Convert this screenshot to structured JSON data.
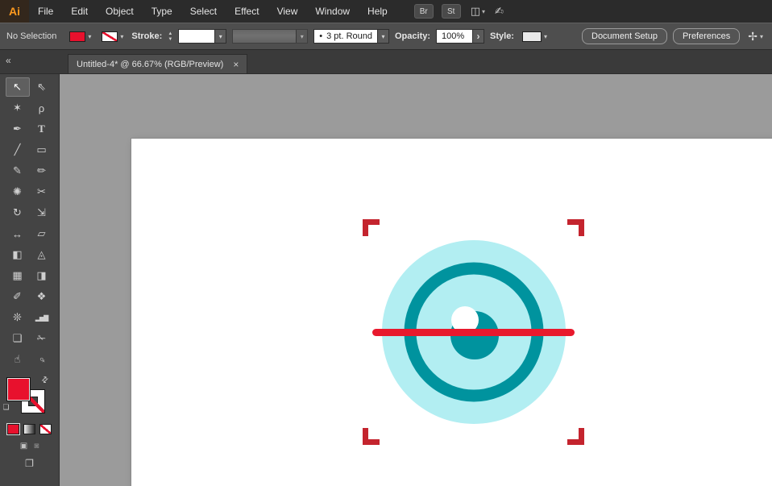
{
  "menu_bar": {
    "logo": "Ai",
    "items": [
      "File",
      "Edit",
      "Object",
      "Type",
      "Select",
      "Effect",
      "View",
      "Window",
      "Help"
    ],
    "bridge_label": "Br",
    "stock_label": "St"
  },
  "glyphs": {
    "dropdown": "▾",
    "stepper_up": "▲",
    "stepper_down": "▼",
    "chevron_right": "›",
    "close": "×",
    "collapse": "«",
    "swap": "⇄",
    "arrange_documents": "◫",
    "touch_workspace": "✍",
    "workspace_switcher": "✢",
    "screen_mode": "❐",
    "draw_normal": "▣",
    "draw_inside": "◙",
    "default_swatches": "❏"
  },
  "control_bar": {
    "selection_status": "No Selection",
    "stroke_label": "Stroke:",
    "brush_dot": "•",
    "brush_value": "3 pt. Round",
    "opacity_label": "Opacity:",
    "opacity_value": "100%",
    "style_label": "Style:",
    "document_setup_label": "Document Setup",
    "preferences_label": "Preferences"
  },
  "document_tab": {
    "title": "Untitled-4* @ 66.67% (RGB/Preview)"
  },
  "toolbar": {
    "tools": [
      {
        "name": "selection-tool",
        "glyph": "↖"
      },
      {
        "name": "direct-selection-tool",
        "glyph": "⇖"
      },
      {
        "name": "magic-wand-tool",
        "glyph": "✶"
      },
      {
        "name": "lasso-tool",
        "glyph": "ρ"
      },
      {
        "name": "pen-tool",
        "glyph": "✒"
      },
      {
        "name": "type-tool",
        "glyph": "T"
      },
      {
        "name": "line-segment-tool",
        "glyph": "╱"
      },
      {
        "name": "rectangle-tool",
        "glyph": "▭"
      },
      {
        "name": "paintbrush-tool",
        "glyph": "✎"
      },
      {
        "name": "pencil-tool",
        "glyph": "✏"
      },
      {
        "name": "blob-brush-tool",
        "glyph": "✺"
      },
      {
        "name": "scissors-tool",
        "glyph": "✂"
      },
      {
        "name": "rotate-tool",
        "glyph": "↻"
      },
      {
        "name": "scale-tool",
        "glyph": "⇲"
      },
      {
        "name": "width-tool",
        "glyph": "↔"
      },
      {
        "name": "free-transform-tool",
        "glyph": "▱"
      },
      {
        "name": "shape-builder-tool",
        "glyph": "◧"
      },
      {
        "name": "perspective-grid-tool",
        "glyph": "◬"
      },
      {
        "name": "mesh-tool",
        "glyph": "▦"
      },
      {
        "name": "gradient-tool",
        "glyph": "◨"
      },
      {
        "name": "eyedropper-tool",
        "glyph": "✐"
      },
      {
        "name": "blend-tool",
        "glyph": "❖"
      },
      {
        "name": "symbol-sprayer-tool",
        "glyph": "❊"
      },
      {
        "name": "column-graph-tool",
        "glyph": "▂▅▇"
      },
      {
        "name": "artboard-tool",
        "glyph": "❏"
      },
      {
        "name": "slice-tool",
        "glyph": "✁"
      },
      {
        "name": "hand-tool",
        "glyph": "☝"
      },
      {
        "name": "zoom-tool",
        "glyph": "♀"
      }
    ]
  },
  "ui_colors": {
    "swatch_red": "#e8112d"
  },
  "artwork": {
    "pale_cyan": "#b2eef2",
    "teal": "#00939e",
    "line_red": "#e8192d",
    "corner_red": "#c4242e",
    "white": "#ffffff"
  }
}
